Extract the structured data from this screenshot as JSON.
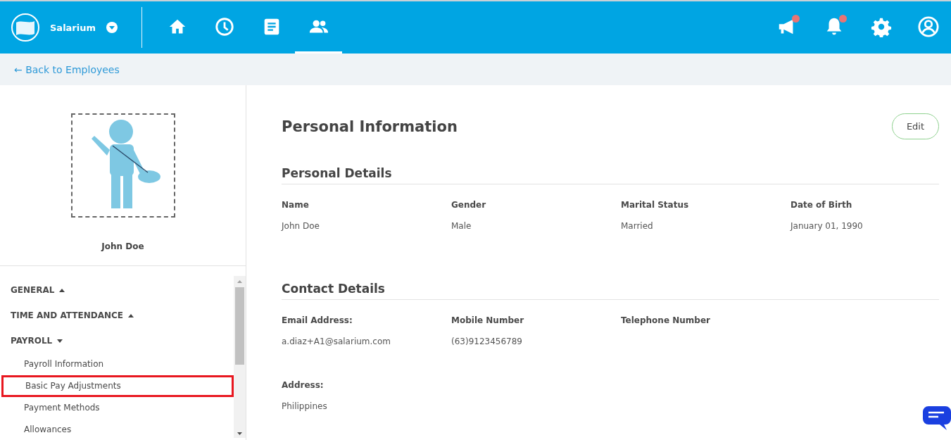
{
  "top_bar": {
    "brand": "Salarium",
    "nav": [
      {
        "kind": "home",
        "selected": false
      },
      {
        "kind": "clock",
        "selected": false
      },
      {
        "kind": "document",
        "selected": false
      },
      {
        "kind": "people",
        "selected": true
      }
    ],
    "actions": [
      {
        "kind": "megaphone",
        "unread": true
      },
      {
        "kind": "bell",
        "unread": true
      },
      {
        "kind": "settings"
      },
      {
        "kind": "account"
      }
    ]
  },
  "back_link": "← Back to Employees",
  "profile": {
    "name": "John Doe"
  },
  "sidebar": {
    "sections": [
      {
        "label": "GENERAL",
        "expanded": false
      },
      {
        "label": "TIME AND ATTENDANCE",
        "expanded": false
      },
      {
        "label": "PAYROLL",
        "expanded": true,
        "items": [
          {
            "label": "Payroll Information",
            "highlighted": false
          },
          {
            "label": "Basic Pay Adjustments",
            "highlighted": true
          },
          {
            "label": "Payment Methods",
            "highlighted": false
          },
          {
            "label": "Allowances",
            "highlighted": false
          }
        ]
      }
    ]
  },
  "page_title": "Personal Information",
  "edit_button": "Edit",
  "sections": [
    {
      "title": "Personal Details",
      "rows": [
        [
          {
            "label": "Name",
            "value": "John Doe"
          },
          {
            "label": "Gender",
            "value": "Male"
          },
          {
            "label": "Marital Status",
            "value": "Married"
          },
          {
            "label": "Date of Birth",
            "value": "January 01, 1990"
          }
        ]
      ]
    },
    {
      "title": "Contact Details",
      "rows": [
        [
          {
            "label": "Email Address:",
            "value": "a.diaz+A1@salarium.com"
          },
          {
            "label": "Mobile Number",
            "value": "(63)9123456789"
          },
          {
            "label": "Telephone Number"
          }
        ],
        [
          {
            "label": "Address:",
            "value": "Philippines"
          }
        ]
      ]
    }
  ]
}
